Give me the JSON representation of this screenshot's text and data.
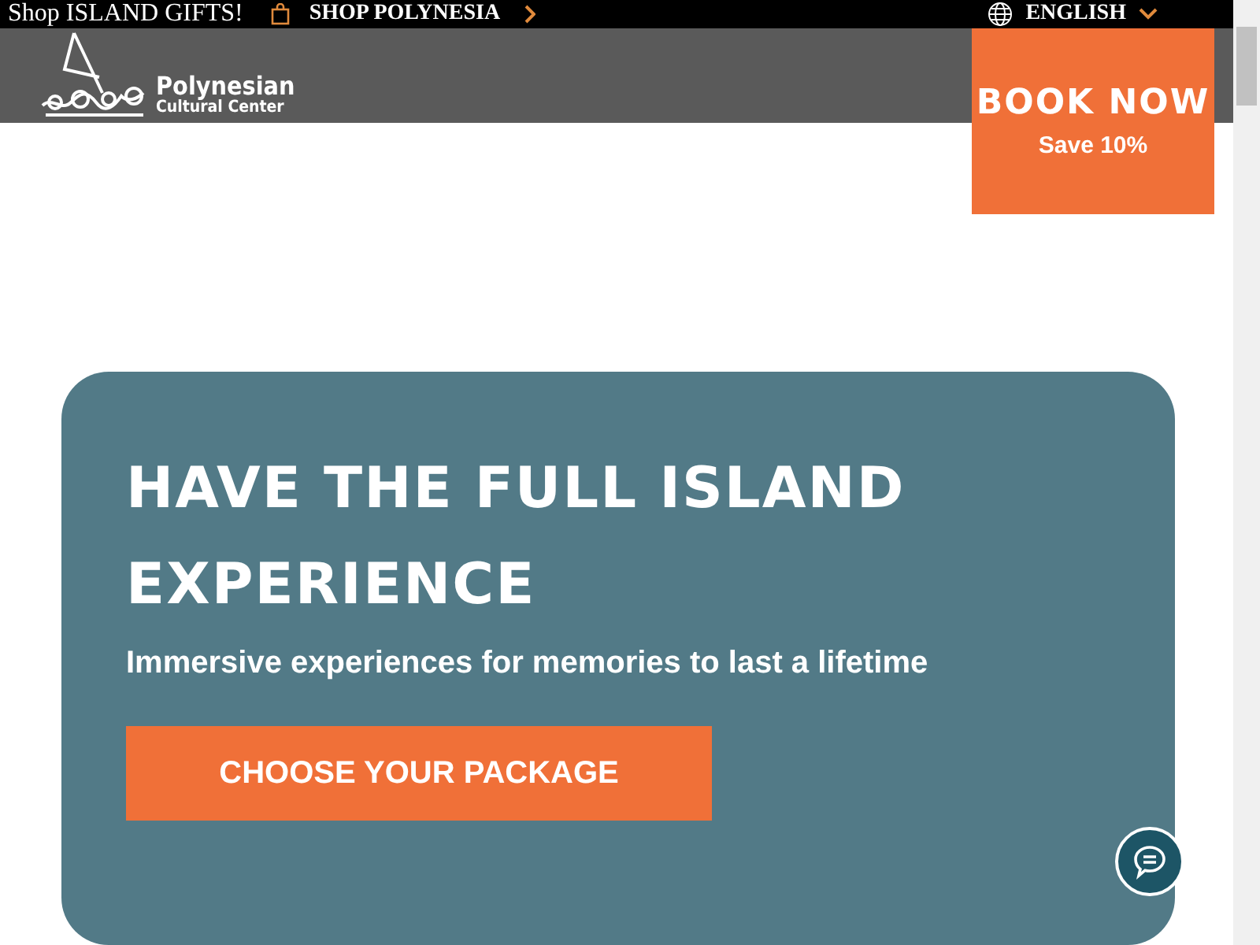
{
  "top_bar": {
    "promo": "Shop ISLAND GIFTS!",
    "shop_link": "SHOP POLYNESIA",
    "language": "ENGLISH"
  },
  "header": {
    "logo_title": "Polynesian",
    "logo_subtitle": "Cultural Center",
    "book": {
      "title": "BOOK NOW",
      "subtitle": "Save 10%"
    }
  },
  "hero": {
    "title": "HAVE THE FULL ISLAND EXPERIENCE",
    "subtitle": "Immersive experiences for memories to last a lifetime",
    "button": "CHOOSE YOUR PACKAGE"
  }
}
